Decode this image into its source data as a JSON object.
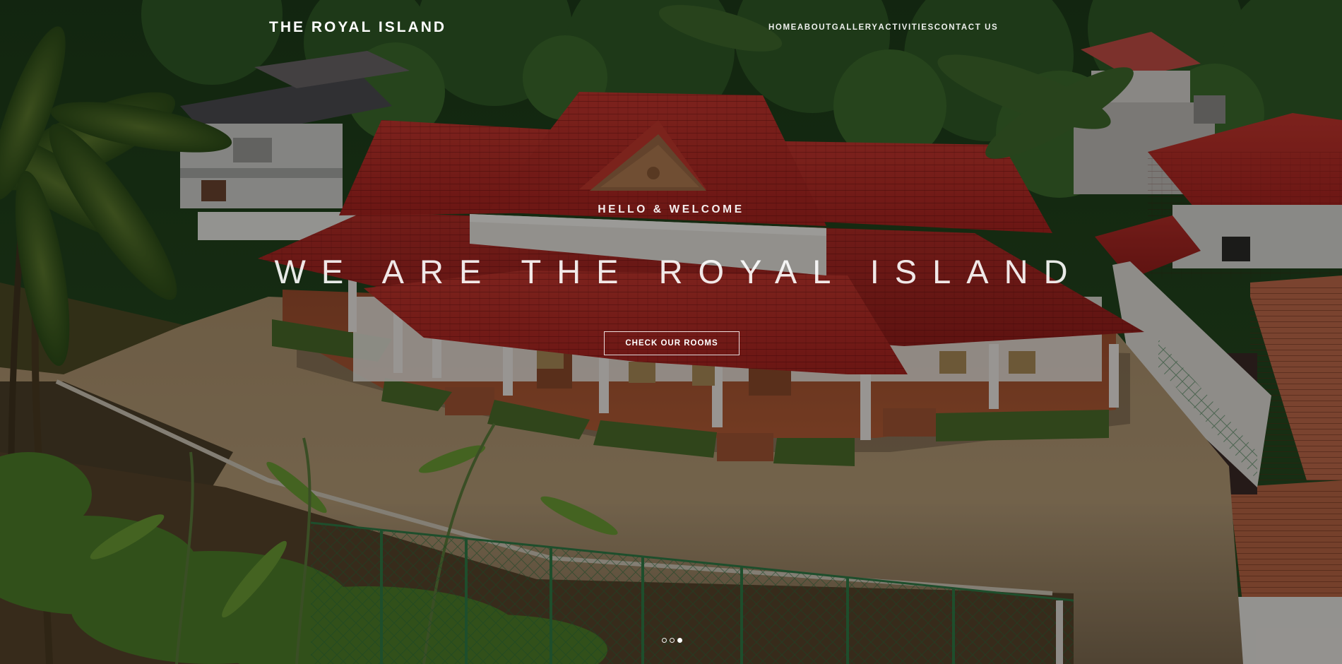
{
  "brand": "THE ROYAL ISLAND",
  "nav": {
    "home": "HOME",
    "about": "ABOUT",
    "gallery": "GALLERY",
    "activities": "ACTIVITIES",
    "contact": "CONTACT US"
  },
  "hero": {
    "subtitle": "HELLO & WELCOME",
    "title": "WE ARE THE ROYAL ISLAND",
    "cta_label": "CHECK OUR ROOMS",
    "active_slide": 3,
    "slide_count": 3
  },
  "colors": {
    "roof": "#b92b25",
    "foliage": "#1f4d1f",
    "ground": "#a58a66",
    "text": "#ffffff"
  }
}
